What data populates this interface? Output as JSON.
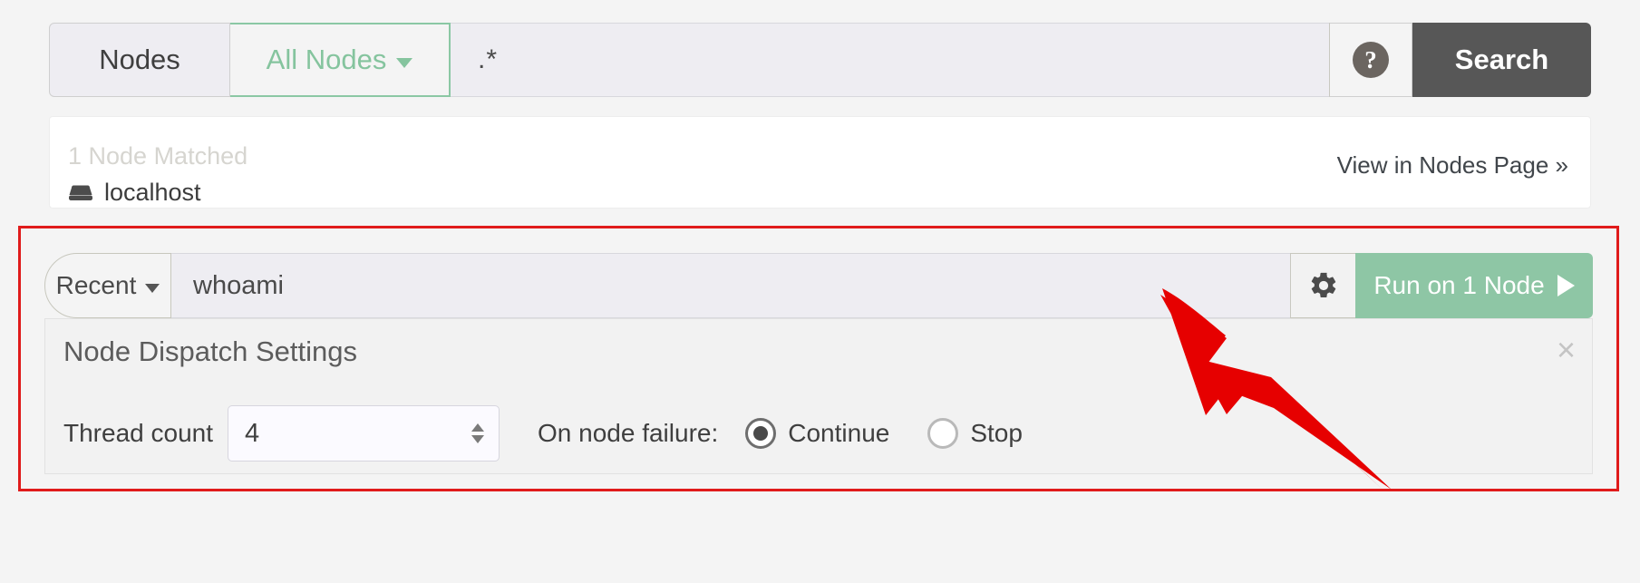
{
  "search": {
    "node_label": "Nodes",
    "filter_label": "All Nodes",
    "query_value": ".*",
    "help_icon": "question-mark-icon",
    "search_button": "Search"
  },
  "matched": {
    "title": "1 Node Matched",
    "node_name": "localhost",
    "node_icon": "server-icon",
    "view_link": "View in Nodes Page »"
  },
  "command": {
    "recent_label": "Recent",
    "command_value": "whoami",
    "gear_icon": "gear-icon",
    "run_label": "Run on 1 Node",
    "play_icon": "play-triangle-icon"
  },
  "dispatch": {
    "title": "Node Dispatch Settings",
    "close_label": "×",
    "thread_label": "Thread count",
    "thread_value": "4",
    "failure_label": "On node failure:",
    "options": [
      {
        "label": "Continue",
        "selected": true
      },
      {
        "label": "Stop",
        "selected": false
      }
    ]
  },
  "colors": {
    "accent_green": "#8ec6a5",
    "search_button": "#575757",
    "highlight_red": "#e01b1b",
    "arrow_red": "#e60000"
  }
}
